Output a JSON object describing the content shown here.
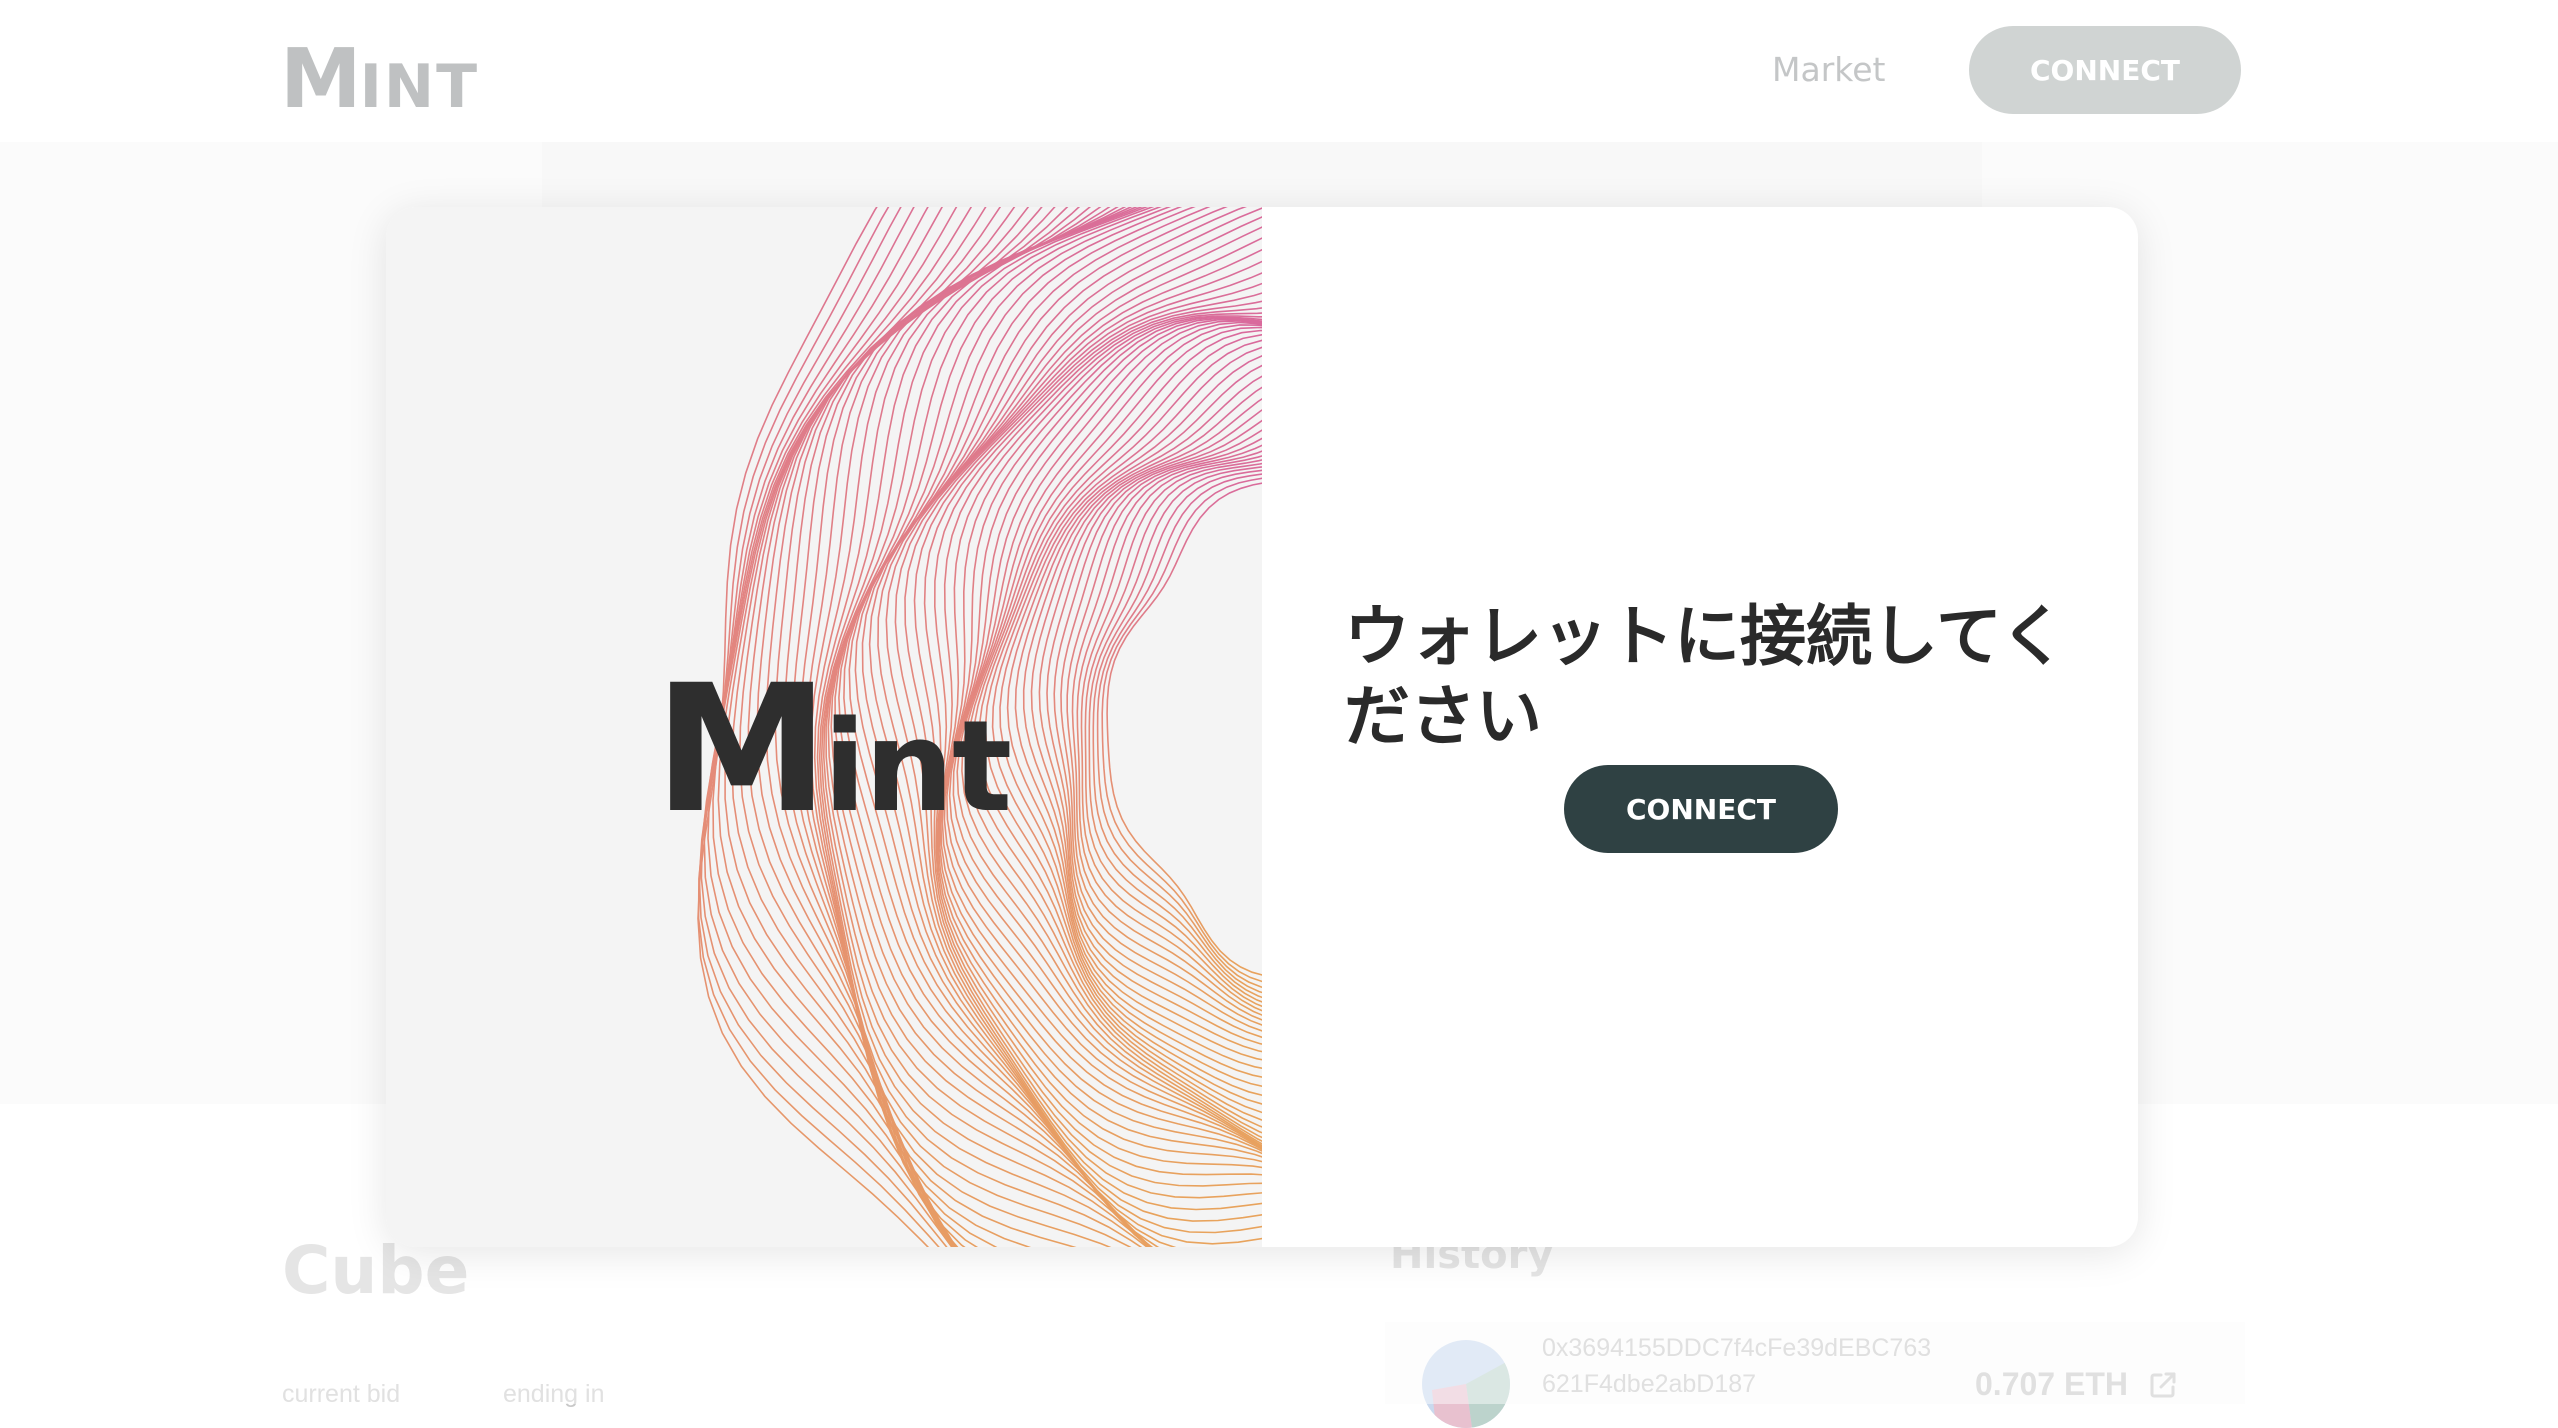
{
  "header": {
    "logo_big": "M",
    "logo_small": "INT",
    "nav_market": "Market",
    "connect_label": "CONNECT"
  },
  "page": {
    "artwork_title": "Cube",
    "current_bid_label": "current bid",
    "ending_in_label": "ending in",
    "history_title": "History",
    "history": [
      {
        "address_line1": "0x3694155DDC7f4cFe39dEBC763",
        "address_line2": "621F4dbe2abD187",
        "amount": "0.707 ETH"
      }
    ]
  },
  "modal": {
    "art_logo_big": "M",
    "art_logo_small": "int",
    "message": "ウォレットに接続してください",
    "connect_label": "CONNECT"
  },
  "colors": {
    "accent_dark": "#2f4143",
    "header_button": "#d0d4d3",
    "ring_top": "#d96a9c",
    "ring_bottom": "#e8a35c"
  },
  "icons": {
    "external_link": "external-link-icon"
  }
}
